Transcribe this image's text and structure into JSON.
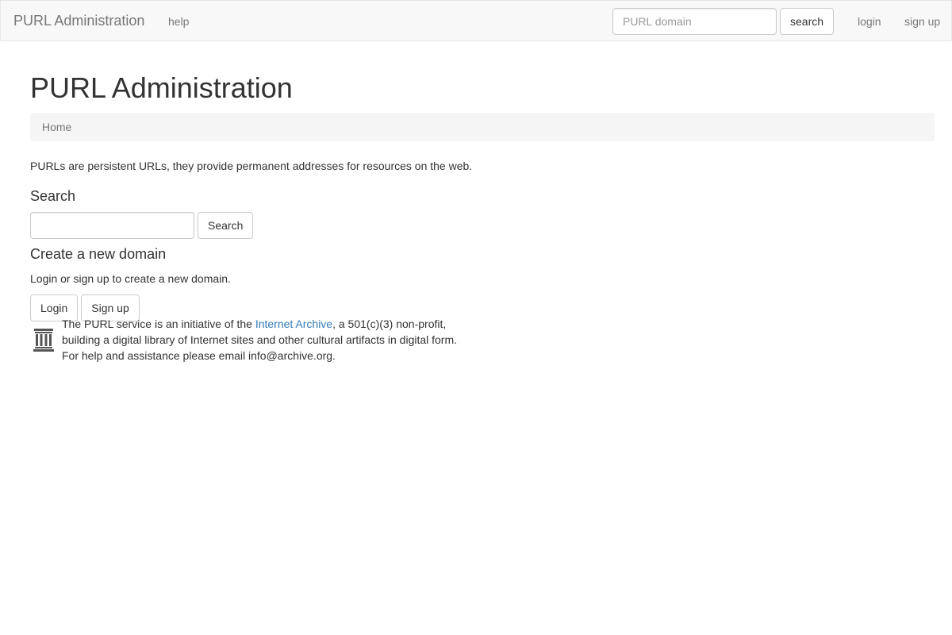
{
  "navbar": {
    "brand": "PURL Administration",
    "help_label": "help",
    "search_placeholder": "PURL domain",
    "search_button": "search",
    "login_label": "login",
    "signup_label": "sign up"
  },
  "main": {
    "title": "PURL Administration",
    "breadcrumb": [
      "Home"
    ],
    "intro": "PURLs are persistent URLs, they provide permanent addresses for resources on the web.",
    "search": {
      "heading": "Search",
      "input_value": "",
      "button": "Search"
    },
    "create": {
      "heading": "Create a new domain",
      "text": "Login or sign up to create a new domain.",
      "login_button": "Login",
      "signup_button": "Sign up"
    }
  },
  "footer": {
    "icon": "archive-building-icon",
    "line1_prefix": "The PURL service is an initiative of the ",
    "link_text": "Internet Archive",
    "line1_suffix": ", a 501(c)(3) non-profit,",
    "line2": "building a digital library of Internet sites and other cultural artifacts in digital form.",
    "line3": "For help and assistance please email info@archive.org."
  },
  "colors": {
    "navbar_bg": "#f8f8f8",
    "link": "#337ab7",
    "muted": "#777777",
    "text": "#333333"
  }
}
